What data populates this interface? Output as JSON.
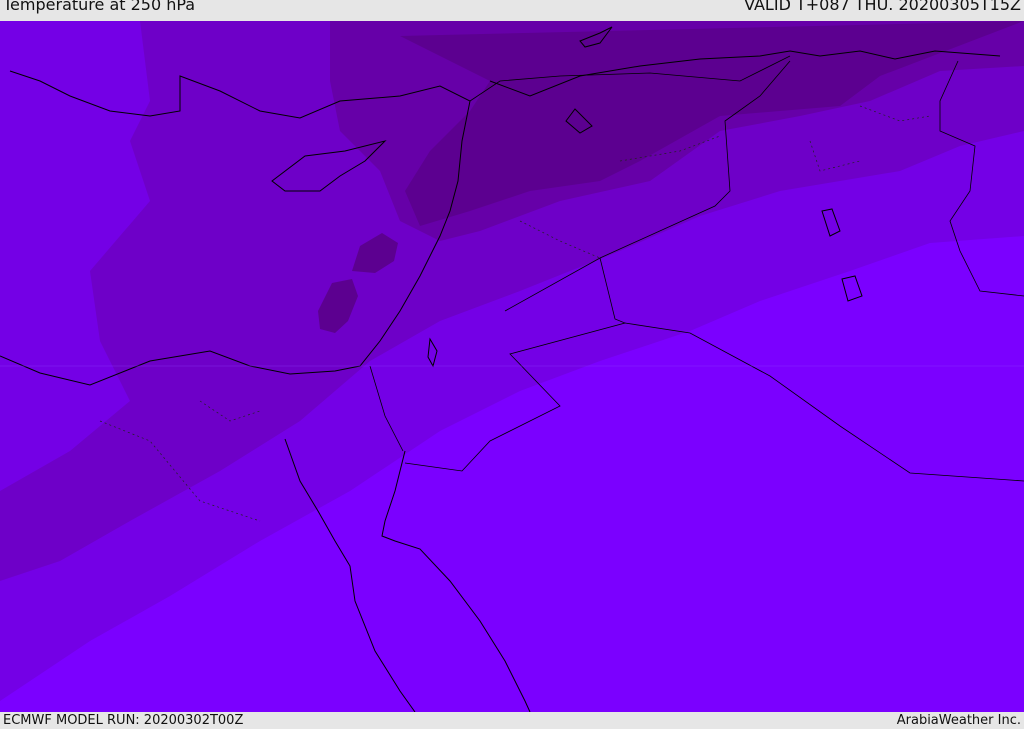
{
  "header": {
    "title": "Temperature at 250 hPa",
    "valid": "VALID T+087 THU. 20200305T15Z"
  },
  "footer": {
    "model_run": "ECMWF MODEL RUN: 20200302T00Z",
    "credit": "ArabiaWeather Inc."
  },
  "colors": {
    "base": "#7b00ff",
    "band_1": "#7400e6",
    "band_2": "#6e00c8",
    "band_3": "#6600a8",
    "band_4": "#5c0090",
    "coastline": "#000000"
  }
}
